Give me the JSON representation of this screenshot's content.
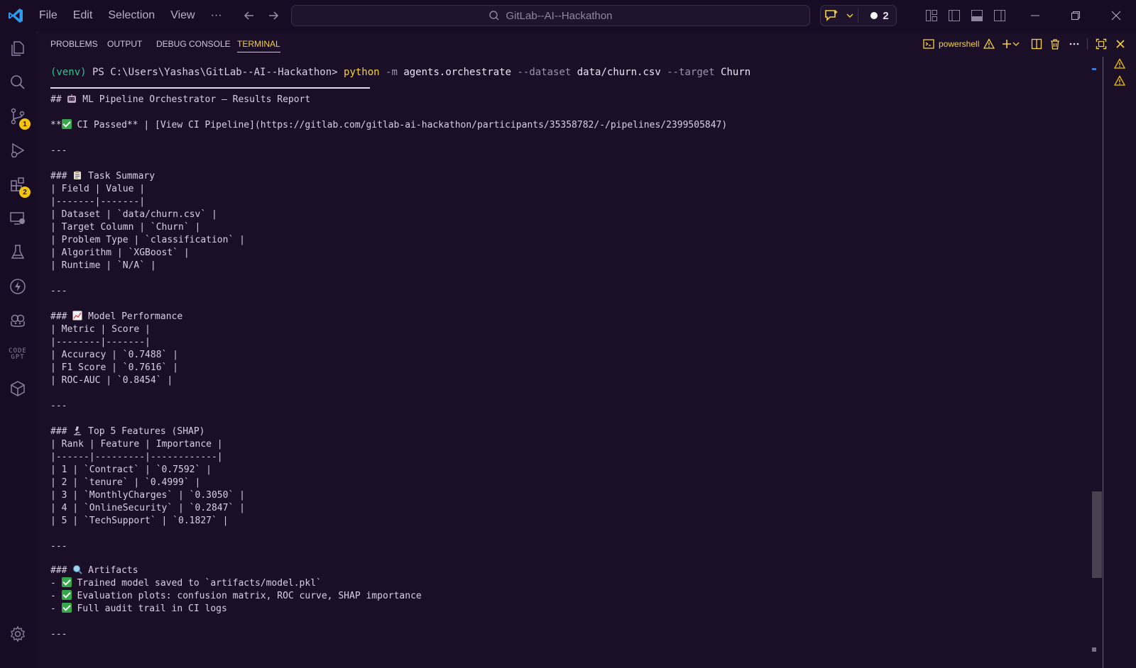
{
  "titlebar": {
    "menu": [
      "File",
      "Edit",
      "Selection",
      "View",
      "···"
    ],
    "search_text": "GitLab--AI--Hackathon",
    "notification_count": "2"
  },
  "activitybar": {
    "items": [
      {
        "icon": "explorer-icon"
      },
      {
        "icon": "search-icon"
      },
      {
        "icon": "source-control-icon",
        "badge": "1"
      },
      {
        "icon": "run-debug-icon"
      },
      {
        "icon": "extensions-icon",
        "badge": "2"
      },
      {
        "icon": "remote-explorer-icon"
      },
      {
        "icon": "testing-icon"
      },
      {
        "icon": "lightning-icon"
      },
      {
        "icon": "copilot-icon"
      },
      {
        "icon": "codegpt-icon",
        "label_top": "CODE",
        "label_bottom": "GPT"
      },
      {
        "icon": "package-icon"
      }
    ],
    "settings_icon": "gear-icon"
  },
  "panel": {
    "tabs": [
      "PROBLEMS",
      "OUTPUT",
      "DEBUG CONSOLE",
      "TERMINAL"
    ],
    "active_tab": "TERMINAL",
    "terminal_name": "powershell"
  },
  "terminal": {
    "command": {
      "venv": "(venv)",
      "prompt": " PS C:\\Users\\Yashas\\GitLab--AI--Hackathon> ",
      "cmd": "python",
      "flag1": " -m ",
      "module": "agents.orchestrate",
      "flag2": " --dataset ",
      "dataset": "data/churn.csv",
      "flag3": " --target ",
      "target": "Churn"
    },
    "report_title": {
      "prefix": "## ",
      "text": " ML Pipeline Orchestrator — Results Report"
    },
    "ci_line": {
      "prefix": "**",
      "text": " CI Passed** | [View CI Pipeline](https://gitlab.com/gitlab-ai-hackathon/participants/35358782/-/pipelines/2399505847)"
    },
    "separator": "---",
    "task_summary": {
      "heading_prefix": "### ",
      "heading": " Task Summary",
      "rows": [
        "| Field | Value |",
        "|-------|-------|",
        "| Dataset | `data/churn.csv` |",
        "| Target Column | `Churn` |",
        "| Problem Type | `classification` |",
        "| Algorithm | `XGBoost` |",
        "| Runtime | `N/A` |"
      ]
    },
    "model_performance": {
      "heading_prefix": "### ",
      "heading": " Model Performance",
      "rows": [
        "| Metric | Score |",
        "|--------|-------|",
        "| Accuracy | `0.7488` |",
        "| F1 Score | `0.7616` |",
        "| ROC-AUC | `0.8454` |"
      ]
    },
    "top_features": {
      "heading_prefix": "### ",
      "heading": " Top 5 Features (SHAP)",
      "rows": [
        "| Rank | Feature | Importance |",
        "|------|---------|------------|",
        "| 1 | `Contract` | `0.7592` |",
        "| 2 | `tenure` | `0.4999` |",
        "| 3 | `MonthlyCharges` | `0.3050` |",
        "| 4 | `OnlineSecurity` | `0.2847` |",
        "| 5 | `TechSupport` | `0.1827` |"
      ]
    },
    "artifacts": {
      "heading_prefix": "### ",
      "heading": " Artifacts",
      "items": [
        "Trained model saved to `artifacts/model.pkl`",
        "Evaluation plots: confusion matrix, ROC curve, SHAP importance",
        "Full audit trail in CI logs"
      ],
      "bullet": "- "
    }
  },
  "colors": {
    "background": "#1b0f28",
    "accent": "#f5d140",
    "venv": "#2fc48f",
    "check": "#35a84a",
    "warning": "#f1c40f"
  }
}
